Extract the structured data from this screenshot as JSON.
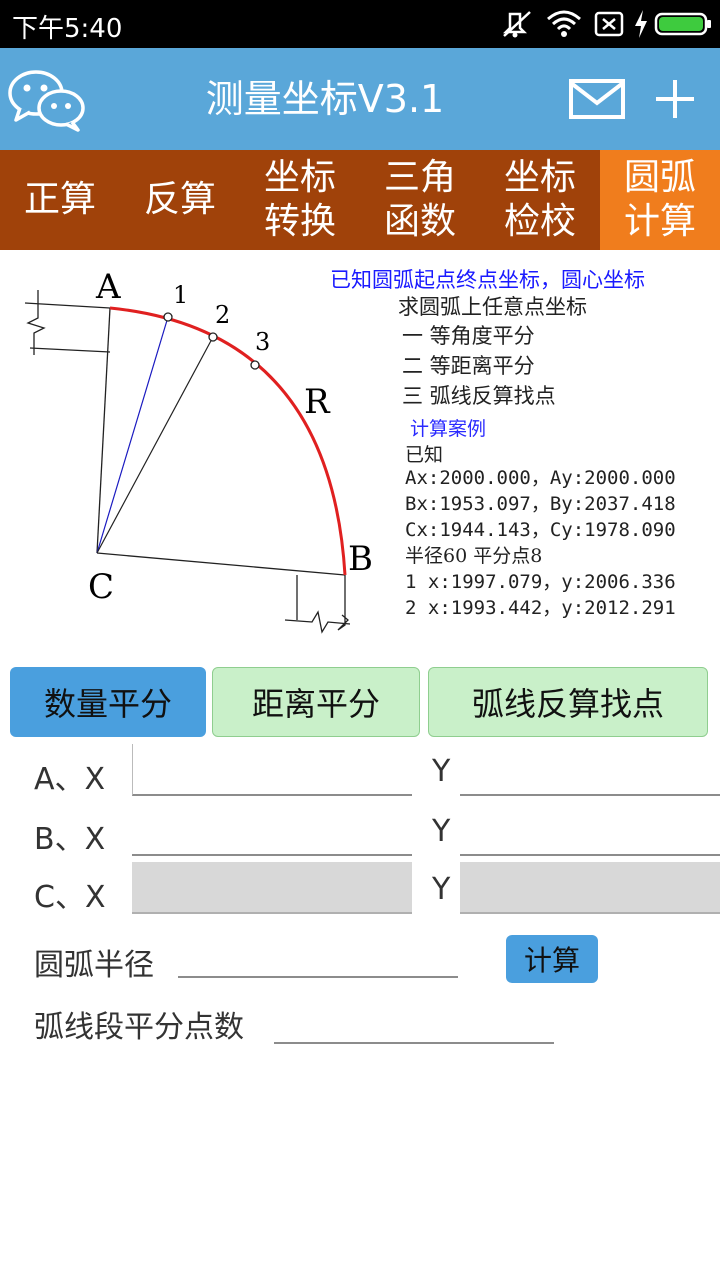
{
  "status": {
    "time": "下午5:40"
  },
  "header": {
    "title": "测量坐标V3.1"
  },
  "tabs": [
    {
      "label": "正算"
    },
    {
      "label": "反算"
    },
    {
      "label": "坐标\n转换"
    },
    {
      "label": "三角\n函数"
    },
    {
      "label": "坐标\n检校"
    },
    {
      "label": "圆弧\n计算",
      "active": true
    }
  ],
  "diagram": {
    "labels": {
      "a": "A",
      "b": "B",
      "c": "C",
      "r": "R",
      "p1": "1",
      "p2": "2",
      "p3": "3"
    },
    "info_title": "已知圆弧起点终点坐标，圆心坐标",
    "info_sub": "求圆弧上任意点坐标",
    "methods": [
      "一  等角度平分",
      "二  等距离平分",
      "三  弧线反算找点"
    ],
    "example_title": "计算案例",
    "example_known": "已知",
    "example_lines": [
      "Ax:2000.000，Ay:2000.000",
      "Bx:1953.097，By:2037.418",
      "Cx:1944.143，Cy:1978.090",
      "半径60    平分点8",
      "1 x:1997.079，y:2006.336",
      "2 x:1993.442，y:2012.291"
    ]
  },
  "modes": {
    "quantity": "数量平分",
    "distance": "距离平分",
    "arc": "弧线反算找点"
  },
  "form": {
    "a_x_label": "A、X",
    "b_x_label": "B、X",
    "c_x_label": "C、X",
    "y_label": "Y",
    "radius_label": "圆弧半径",
    "points_label": "弧线段平分点数",
    "calc_label": "计算"
  },
  "colors": {
    "header": "#5aa7d9",
    "tabbar": "#a0420a",
    "tab_active": "#f07d1d",
    "mode_active": "#4a9fde",
    "mode_inactive": "#c9f0c9",
    "arc": "#e02020"
  },
  "icons": [
    "wechat-icon",
    "mail-icon",
    "plus-icon",
    "mute-icon",
    "wifi-icon",
    "no-sim-icon",
    "charging-icon",
    "battery-icon"
  ]
}
